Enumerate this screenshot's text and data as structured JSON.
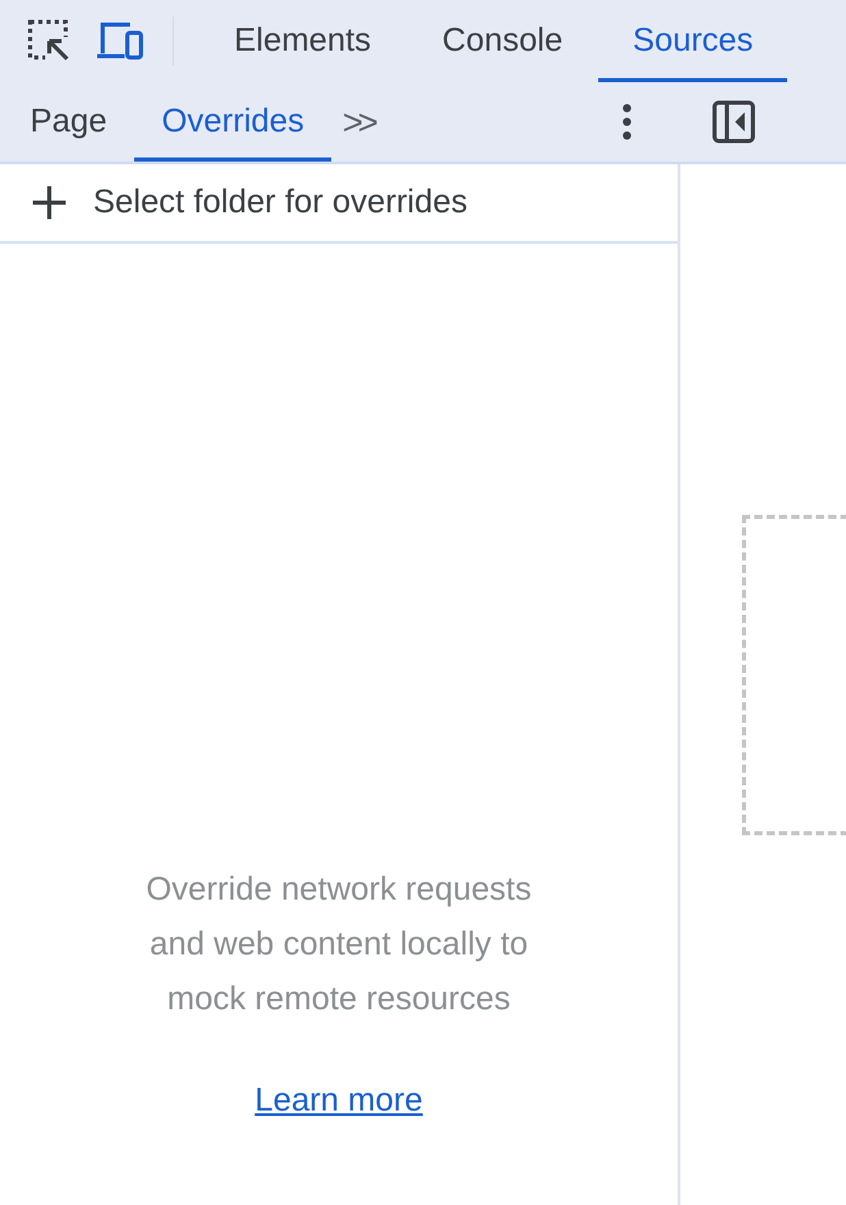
{
  "main_tabs": [
    {
      "label": "Elements",
      "selected": false
    },
    {
      "label": "Console",
      "selected": false
    },
    {
      "label": "Sources",
      "selected": true
    }
  ],
  "sub_tabs": [
    {
      "label": "Page",
      "selected": false
    },
    {
      "label": "Overrides",
      "selected": true
    }
  ],
  "more_tabs": ">>",
  "add_folder": {
    "label": "Select folder for overrides"
  },
  "empty_message": "Override network requests and web content locally to mock remote resources",
  "learn_more": "Learn more"
}
